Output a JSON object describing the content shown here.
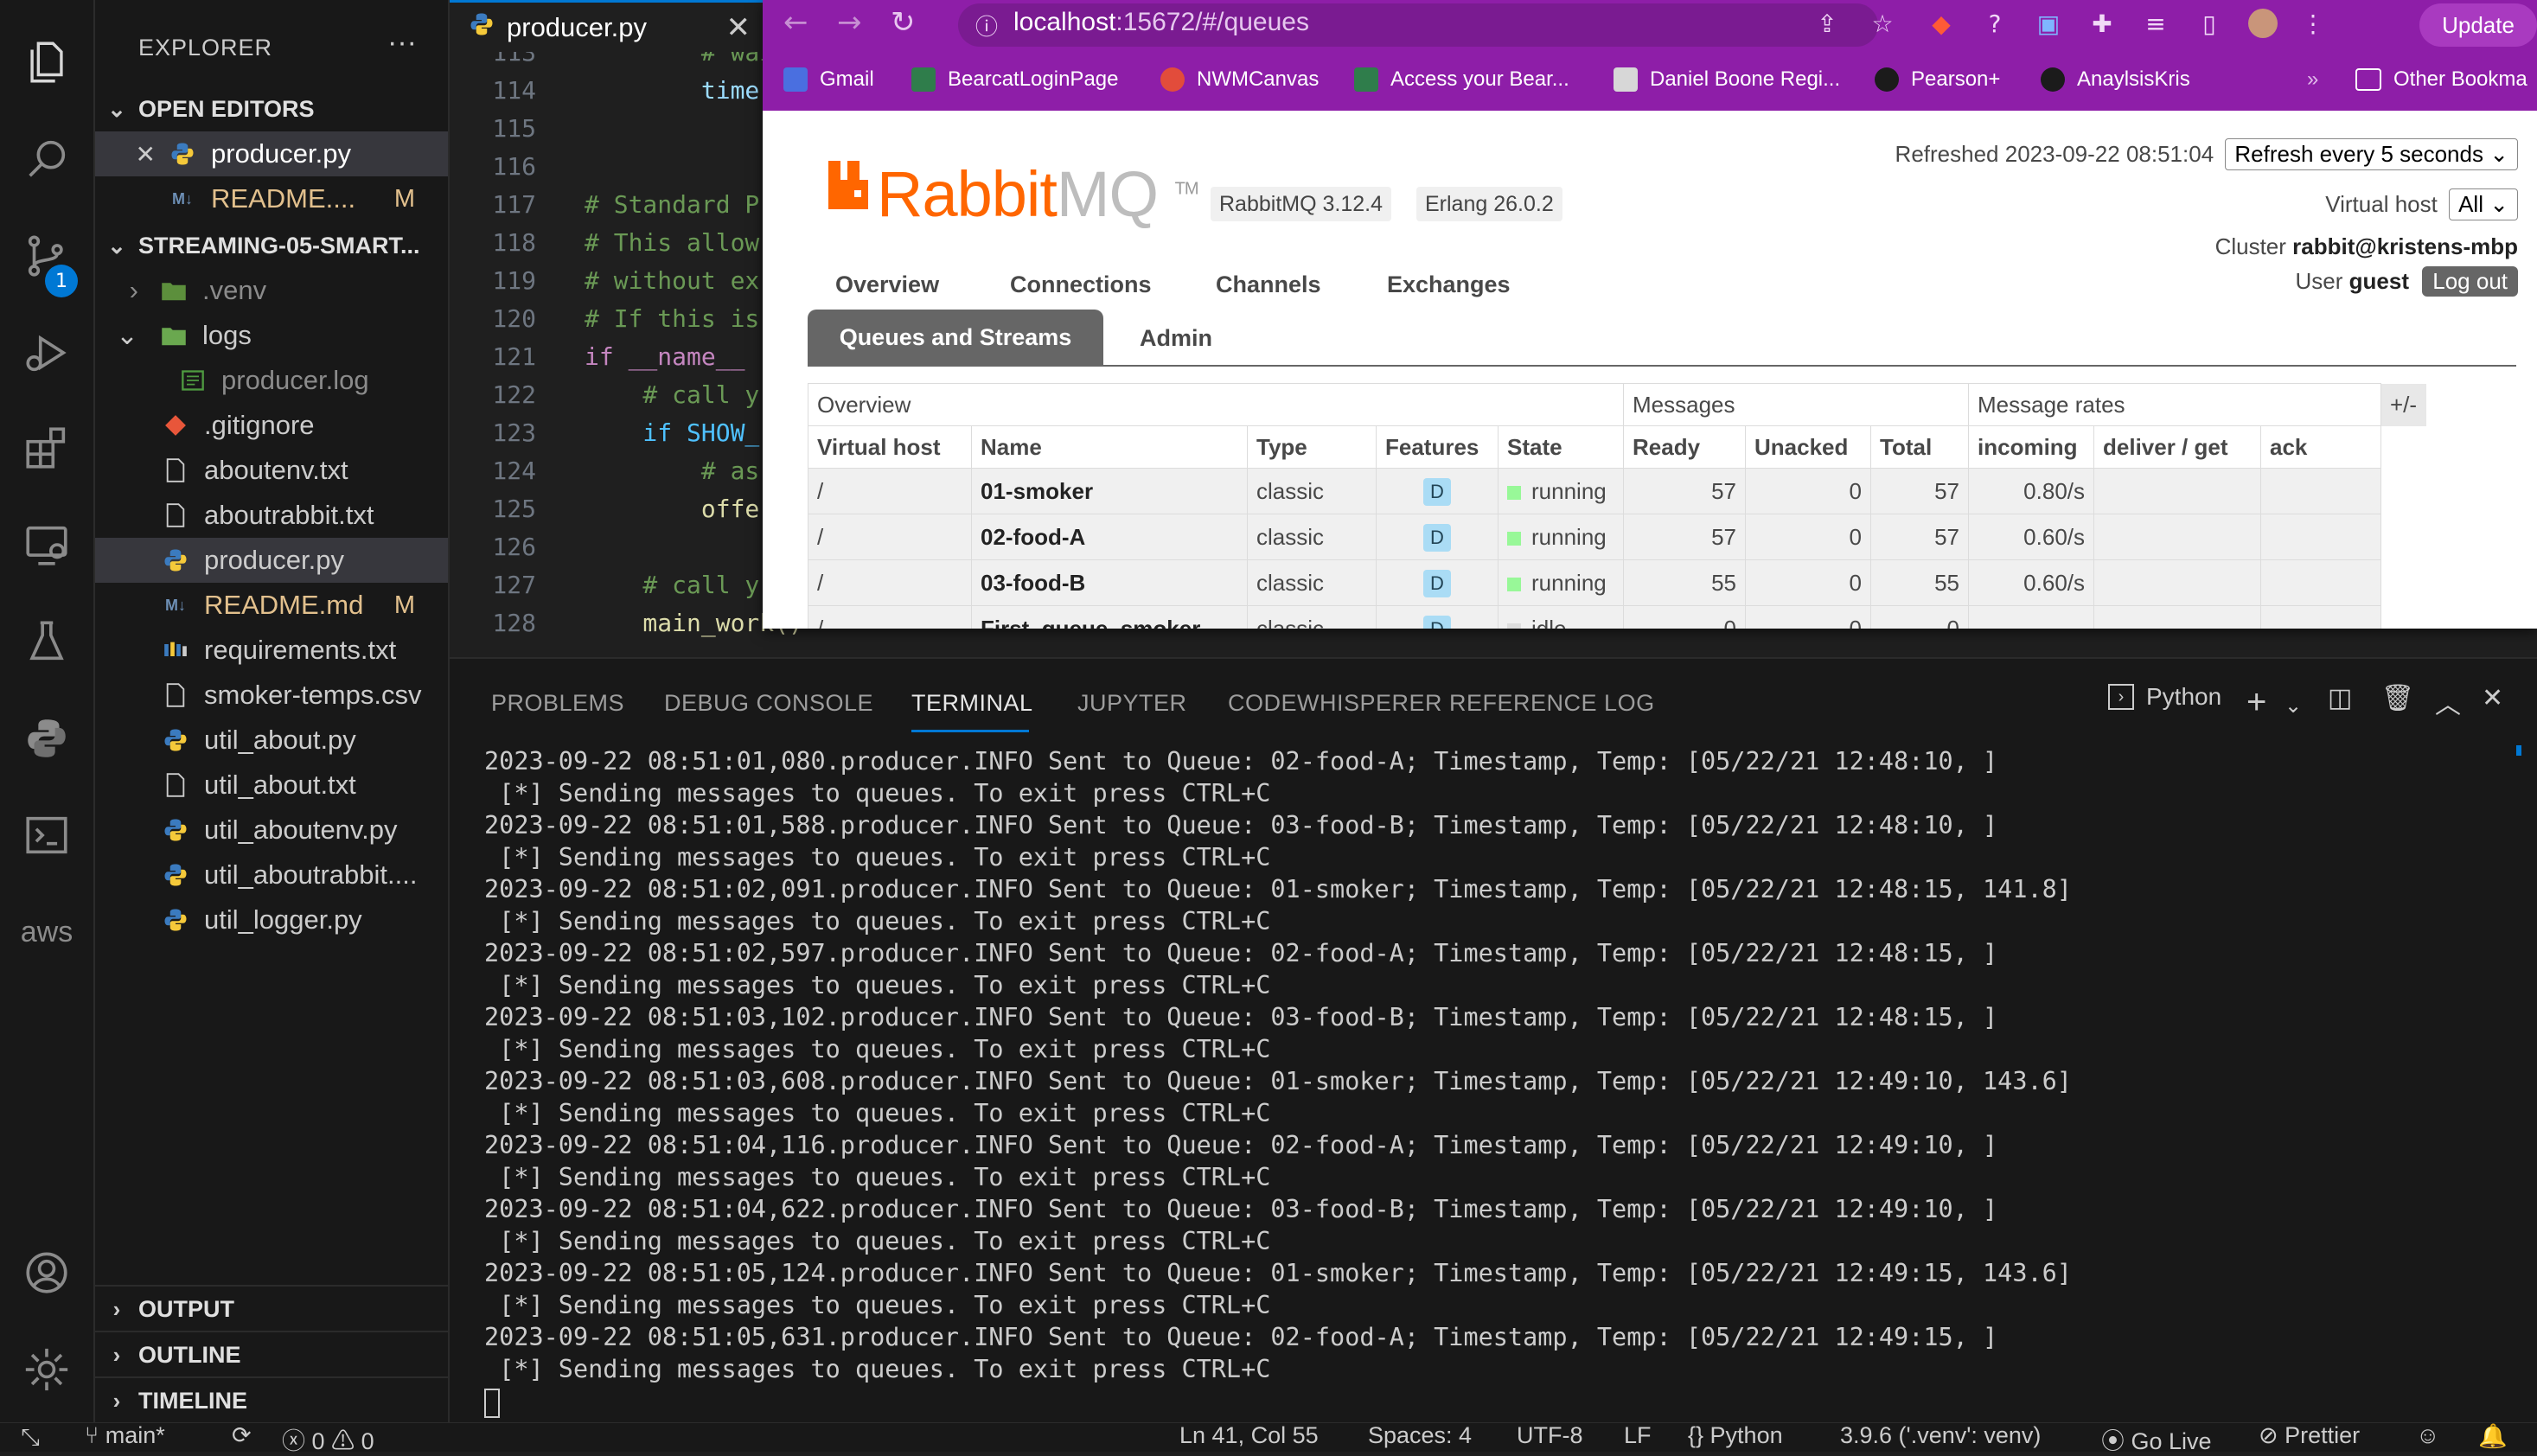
{
  "activity_bar": {
    "icons": [
      "files-icon",
      "search-icon",
      "source-control-icon",
      "run-debug-icon",
      "extensions-icon",
      "remote-explorer-icon",
      "testing-icon",
      "python-icon",
      "terminal-icon",
      "aws-icon",
      "account-icon",
      "settings-gear-icon"
    ],
    "scm_badge": "1",
    "aws_label": "aws"
  },
  "explorer": {
    "title": "EXPLORER",
    "more": "···",
    "open_editors_label": "OPEN EDITORS",
    "open_editors": [
      {
        "name": "producer.py",
        "close": "✕"
      },
      {
        "name": "README....",
        "git": "M"
      }
    ],
    "project_label": "STREAMING-05-SMART...",
    "tree": [
      {
        "name": ".venv",
        "kind": "folder",
        "state": "closed"
      },
      {
        "name": "logs",
        "kind": "folder",
        "state": "open"
      },
      {
        "name": "producer.log",
        "kind": "log"
      },
      {
        "name": ".gitignore",
        "kind": "git"
      },
      {
        "name": "aboutenv.txt",
        "kind": "txt"
      },
      {
        "name": "aboutrabbit.txt",
        "kind": "txt"
      },
      {
        "name": "producer.py",
        "kind": "py"
      },
      {
        "name": "README.md",
        "kind": "md",
        "git": "M"
      },
      {
        "name": "requirements.txt",
        "kind": "req"
      },
      {
        "name": "smoker-temps.csv",
        "kind": "txt"
      },
      {
        "name": "util_about.py",
        "kind": "py"
      },
      {
        "name": "util_about.txt",
        "kind": "txt"
      },
      {
        "name": "util_aboutenv.py",
        "kind": "py"
      },
      {
        "name": "util_aboutrabbit....",
        "kind": "py"
      },
      {
        "name": "util_logger.py",
        "kind": "py"
      }
    ],
    "bottom_sections": [
      "OUTPUT",
      "OUTLINE",
      "TIMELINE"
    ]
  },
  "editor": {
    "active_tab": "producer.py",
    "tab_close": "✕",
    "second_tab_icon": "M↓",
    "lines": [
      {
        "n": "113",
        "t": "        # wait"
      },
      {
        "n": "114",
        "t": "        time.sle"
      },
      {
        "n": "115",
        "t": ""
      },
      {
        "n": "116",
        "t": ""
      },
      {
        "n": "117",
        "t": "# Standard P"
      },
      {
        "n": "118",
        "t": "# This allow"
      },
      {
        "n": "119",
        "t": "# without ex"
      },
      {
        "n": "120",
        "t": "# If this is"
      },
      {
        "n": "121",
        "t": "if __name__ "
      },
      {
        "n": "122",
        "t": "    # call y"
      },
      {
        "n": "123",
        "t": "    if SHOW_"
      },
      {
        "n": "124",
        "t": "        # as"
      },
      {
        "n": "125",
        "t": "        offe"
      },
      {
        "n": "126",
        "t": ""
      },
      {
        "n": "127",
        "t": "    # call y"
      },
      {
        "n": "128",
        "t": "    main_work()"
      }
    ]
  },
  "browser": {
    "url_host": "localhost",
    "url_rest": ":15672/#/queues",
    "update_label": "Update",
    "bookmarks": [
      "Gmail",
      "BearcatLoginPage",
      "NWMCanvas",
      "Access your Bear...",
      "Daniel Boone Regi...",
      "Pearson+",
      "AnaylsisKris"
    ],
    "bookmarks_overflow": "»",
    "other_bookmarks": "Other Bookma",
    "colors": {
      "frame": "#8e1ea8",
      "rabbit_orange": "#ff6600"
    }
  },
  "rabbitmq": {
    "logo_rabbit": "Rabbit",
    "logo_mq": "MQ",
    "logo_tm": "TM",
    "version": "RabbitMQ 3.12.4",
    "erlang": "Erlang 26.0.2",
    "refreshed": "Refreshed 2023-09-22 08:51:04",
    "refresh_option": "Refresh every 5 seconds",
    "vhost_label": "Virtual host",
    "vhost_value": "All",
    "cluster_label": "Cluster",
    "cluster_value": "rabbit@kristens-mbp",
    "user_label": "User",
    "user_value": "guest",
    "logout": "Log out",
    "nav": [
      "Overview",
      "Connections",
      "Channels",
      "Exchanges"
    ],
    "nav_active": "Queues and Streams",
    "nav_admin": "Admin",
    "table": {
      "group_headers": {
        "overview": "Overview",
        "messages": "Messages",
        "rates": "Message rates"
      },
      "plus_minus": "+/-",
      "columns": [
        "Virtual host",
        "Name",
        "Type",
        "Features",
        "State",
        "Ready",
        "Unacked",
        "Total",
        "incoming",
        "deliver / get",
        "ack"
      ],
      "rows": [
        {
          "vhost": "/",
          "name": "01-smoker",
          "type": "classic",
          "feature": "D",
          "state": "running",
          "ready": "57",
          "unacked": "0",
          "total": "57",
          "incoming": "0.80/s",
          "deliver": "",
          "ack": ""
        },
        {
          "vhost": "/",
          "name": "02-food-A",
          "type": "classic",
          "feature": "D",
          "state": "running",
          "ready": "57",
          "unacked": "0",
          "total": "57",
          "incoming": "0.60/s",
          "deliver": "",
          "ack": ""
        },
        {
          "vhost": "/",
          "name": "03-food-B",
          "type": "classic",
          "feature": "D",
          "state": "running",
          "ready": "55",
          "unacked": "0",
          "total": "55",
          "incoming": "0.60/s",
          "deliver": "",
          "ack": ""
        },
        {
          "vhost": "/",
          "name": "First_queue_smoker",
          "type": "classic",
          "feature": "D",
          "state": "idle",
          "ready": "0",
          "unacked": "0",
          "total": "0",
          "incoming": "",
          "deliver": "",
          "ack": ""
        }
      ]
    }
  },
  "panel": {
    "tabs": [
      "PROBLEMS",
      "DEBUG CONSOLE",
      "TERMINAL",
      "JUPYTER",
      "CODEWHISPERER REFERENCE LOG"
    ],
    "active_tab": "TERMINAL",
    "shell_label": "Python",
    "terminal_lines": [
      "2023-09-22 08:51:01,080.producer.INFO Sent to Queue: 02-food-A; Timestamp, Temp: [05/22/21 12:48:10, ]",
      " [*] Sending messages to queues. To exit press CTRL+C",
      "2023-09-22 08:51:01,588.producer.INFO Sent to Queue: 03-food-B; Timestamp, Temp: [05/22/21 12:48:10, ]",
      " [*] Sending messages to queues. To exit press CTRL+C",
      "2023-09-22 08:51:02,091.producer.INFO Sent to Queue: 01-smoker; Timestamp, Temp: [05/22/21 12:48:15, 141.8]",
      " [*] Sending messages to queues. To exit press CTRL+C",
      "2023-09-22 08:51:02,597.producer.INFO Sent to Queue: 02-food-A; Timestamp, Temp: [05/22/21 12:48:15, ]",
      " [*] Sending messages to queues. To exit press CTRL+C",
      "2023-09-22 08:51:03,102.producer.INFO Sent to Queue: 03-food-B; Timestamp, Temp: [05/22/21 12:48:15, ]",
      " [*] Sending messages to queues. To exit press CTRL+C",
      "2023-09-22 08:51:03,608.producer.INFO Sent to Queue: 01-smoker; Timestamp, Temp: [05/22/21 12:49:10, 143.6]",
      " [*] Sending messages to queues. To exit press CTRL+C",
      "2023-09-22 08:51:04,116.producer.INFO Sent to Queue: 02-food-A; Timestamp, Temp: [05/22/21 12:49:10, ]",
      " [*] Sending messages to queues. To exit press CTRL+C",
      "2023-09-22 08:51:04,622.producer.INFO Sent to Queue: 03-food-B; Timestamp, Temp: [05/22/21 12:49:10, ]",
      " [*] Sending messages to queues. To exit press CTRL+C",
      "2023-09-22 08:51:05,124.producer.INFO Sent to Queue: 01-smoker; Timestamp, Temp: [05/22/21 12:49:15, 143.6]",
      " [*] Sending messages to queues. To exit press CTRL+C",
      "2023-09-22 08:51:05,631.producer.INFO Sent to Queue: 02-food-A; Timestamp, Temp: [05/22/21 12:49:15, ]",
      " [*] Sending messages to queues. To exit press CTRL+C"
    ]
  },
  "statusbar": {
    "branch": "main*",
    "errors": "0",
    "warnings": "0",
    "position": "Ln 41, Col 55",
    "spaces": "Spaces: 4",
    "encoding": "UTF-8",
    "eol": "LF",
    "language": "Python",
    "interpreter": "3.9.6 ('.venv': venv)",
    "golive": "Go Live",
    "prettier": "Prettier"
  }
}
